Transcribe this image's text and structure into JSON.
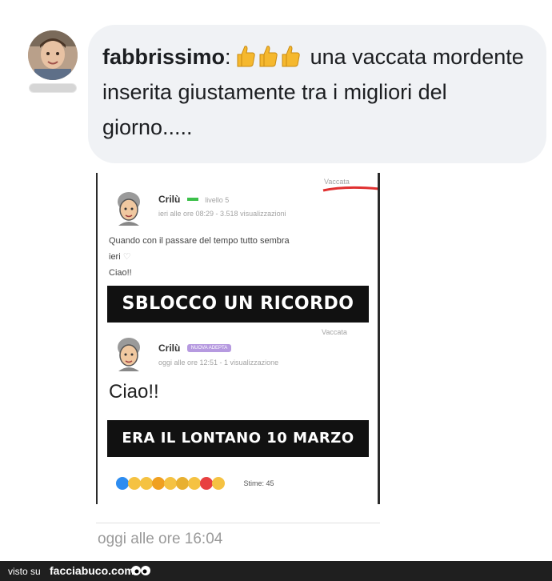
{
  "comment": {
    "author": "fabbrissimo",
    "separator": ":",
    "text": "una vaccata mordente inserita giustamente tra i migliori del giorno.....",
    "reaction_icons": [
      "thumbs-up-icon",
      "thumbs-up-icon",
      "thumbs-up-icon"
    ],
    "timestamp": "oggi alle ore 16:04"
  },
  "embedded_post": {
    "corner_tag_1": "Vaccata",
    "author_1": "Crilù",
    "level_1": "livello 5",
    "meta_1": "ieri alle ore 08:29 - 3.518 visualizzazioni",
    "body_line_1": "Quando con il passare del tempo tutto sembra",
    "body_line_2": "ieri",
    "body_line_3": "Ciao!!",
    "banner_1": "SBLOCCO UN RICORDO",
    "corner_tag_2": "Vaccata",
    "author_2": "Crilù",
    "badge_2": "NUOVA ADEPTA",
    "meta_2": "oggi alle ore 12:51 - 1 visualizzazione",
    "big_text_2": "Ciao!!",
    "banner_2": "ERA IL LONTANO 10 MARZO",
    "stime_label": "Stime: 45"
  },
  "footer": {
    "prefix": "visto su",
    "brand": "facciabuco.com"
  },
  "colors": {
    "bubble_bg": "#f0f2f5",
    "footer_bg": "#1f1f1f",
    "accent_red": "#e03030",
    "badge_purple": "#b69ae0",
    "level_green": "#3cc04a"
  }
}
